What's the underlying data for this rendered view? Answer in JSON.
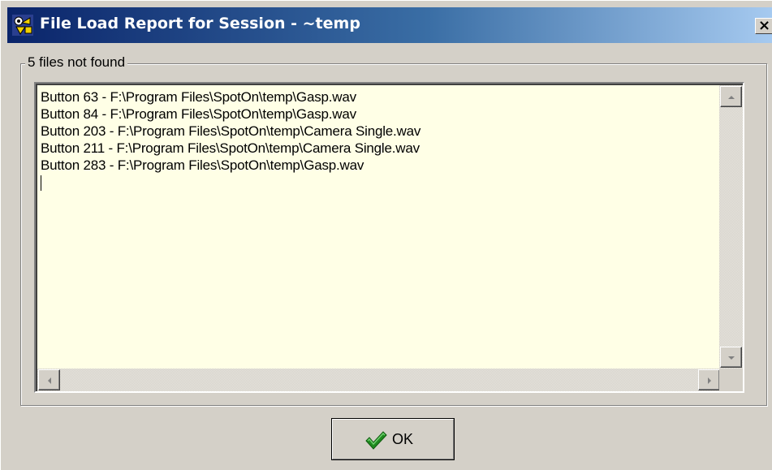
{
  "window": {
    "title": "File Load Report for Session - ~temp",
    "close_glyph": "✕"
  },
  "group": {
    "legend": "5 files not found"
  },
  "memo": {
    "lines": [
      "Button 63 - F:\\Program Files\\SpotOn\\temp\\Gasp.wav",
      "Button 84 - F:\\Program Files\\SpotOn\\temp\\Gasp.wav",
      "Button 203 - F:\\Program Files\\SpotOn\\temp\\Camera Single.wav",
      "Button 211 - F:\\Program Files\\SpotOn\\temp\\Camera Single.wav",
      "Button 283 - F:\\Program Files\\SpotOn\\temp\\Gasp.wav"
    ],
    "background": "#ffffe6"
  },
  "buttons": {
    "ok_label": "OK",
    "ok_icon": "checkmark-icon"
  },
  "colors": {
    "titlebar_start": "#0a246a",
    "titlebar_end": "#a6caf0",
    "dialog_face": "#d4d0c8",
    "checkmark": "#1f8a1f"
  },
  "icons": {
    "app": "spoton-app-icon",
    "close": "close-icon",
    "scroll_up": "arrow-up-icon",
    "scroll_down": "arrow-down-icon",
    "scroll_left": "arrow-left-icon",
    "scroll_right": "arrow-right-icon"
  }
}
